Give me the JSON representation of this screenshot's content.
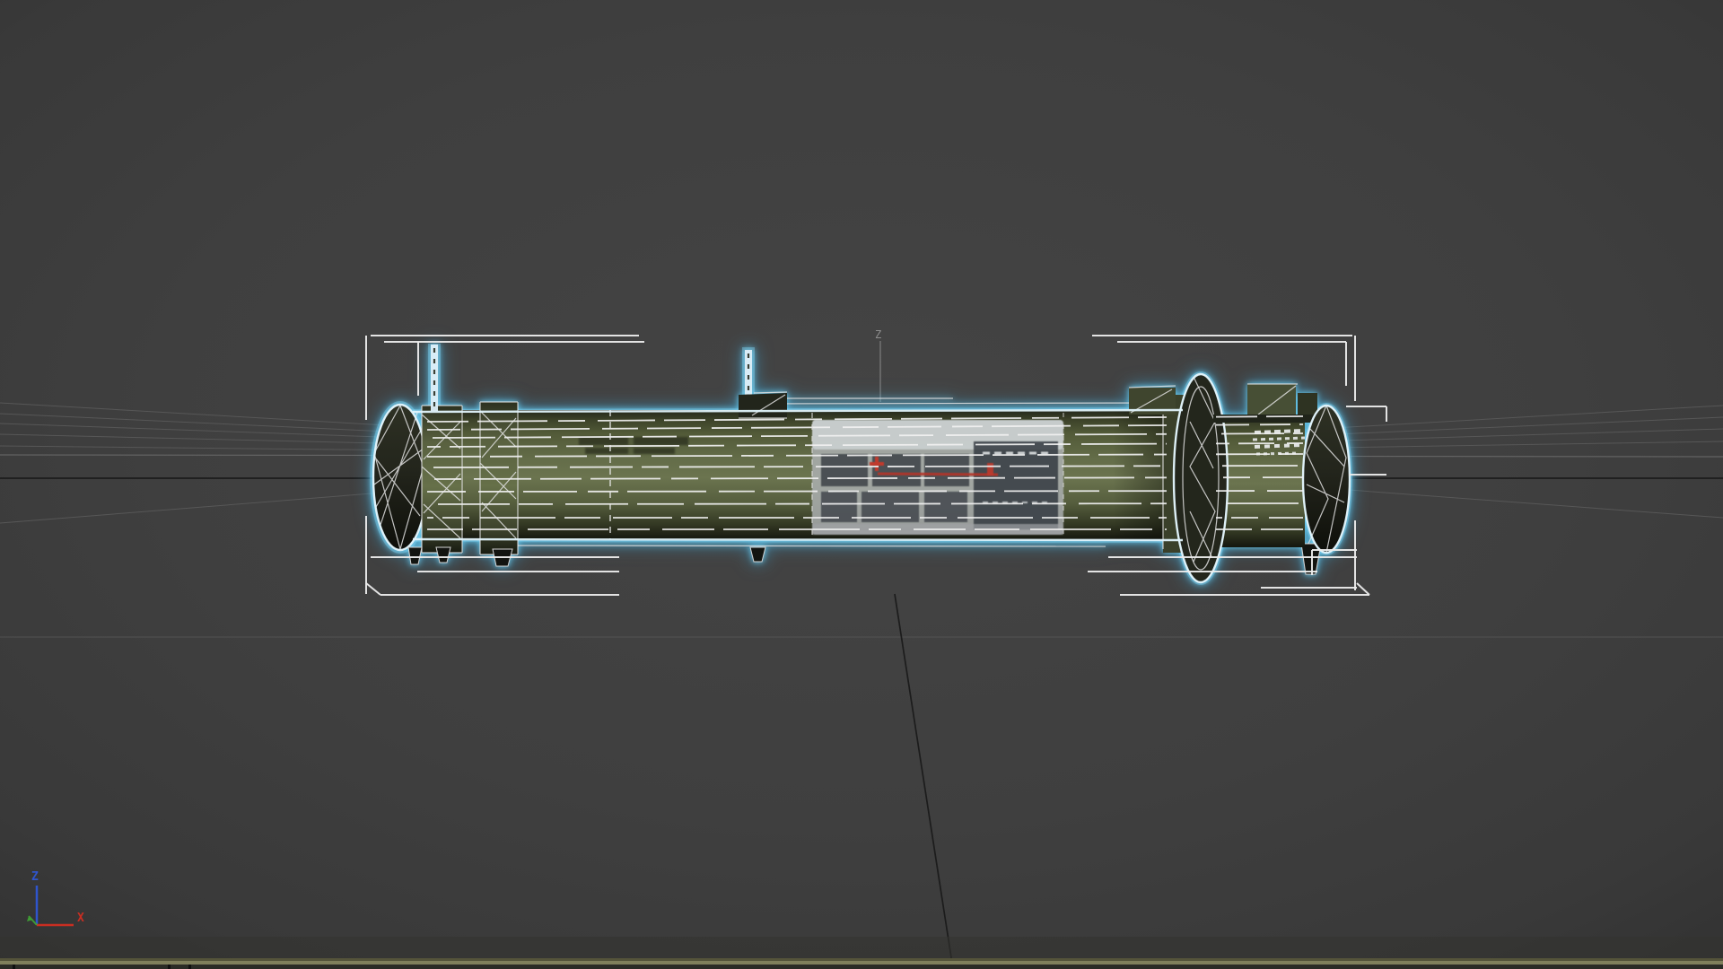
{
  "viewport": {
    "kind": "3d-perspective-viewport",
    "origin_axis_label": "Z",
    "selection": "wireframe launch-tube model selected (cyan highlight with white bounding brackets)"
  },
  "axis_gizmo": {
    "z_label": "Z",
    "x_label": "X"
  },
  "palette": {
    "background": "#414141",
    "background_edge": "#343434",
    "grid_line": "#575757",
    "grid_bright": "#6b6b6b",
    "grid_major_dark": "#1c1c1c",
    "selection_glow_cyan": "#5bc6ea",
    "wireframe_white": "#f1f1f1",
    "bracket_white": "#ececec",
    "tube_green": "#5c6442",
    "tube_green_light": "#6e7852",
    "tube_shadow": "#23261a",
    "decal_light": "#b5b9bb",
    "decal_panel": "#3b4046",
    "decal_red": "#c03a2c",
    "origin_label_gray": "#8e8e8e",
    "axis_z_blue": "#2f55cc",
    "axis_x_red": "#c92e22",
    "axis_y_green": "#3f9b35",
    "timeline_line_olive": "#807f5c",
    "timeline_bed": "#2b2b26"
  }
}
